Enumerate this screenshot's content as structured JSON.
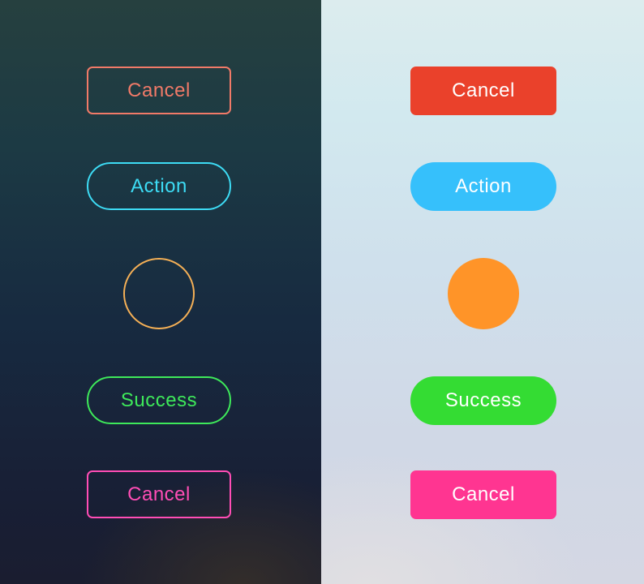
{
  "dark_panel": {
    "cancel_top": {
      "label": "Cancel",
      "color": "#f17a68"
    },
    "action": {
      "label": "Action",
      "color": "#3ddcf5"
    },
    "circle": {
      "color": "#f5b056"
    },
    "success": {
      "label": "Success",
      "color": "#3ee95a"
    },
    "cancel_bottom": {
      "label": "Cancel",
      "color": "#ff4db5"
    }
  },
  "light_panel": {
    "cancel_top": {
      "label": "Cancel",
      "color": "#ea412b"
    },
    "action": {
      "label": "Action",
      "color": "#36c0fb"
    },
    "circle": {
      "color": "#ff9428"
    },
    "success": {
      "label": "Success",
      "color": "#34dc33"
    },
    "cancel_bottom": {
      "label": "Cancel",
      "color": "#ff3591"
    }
  }
}
